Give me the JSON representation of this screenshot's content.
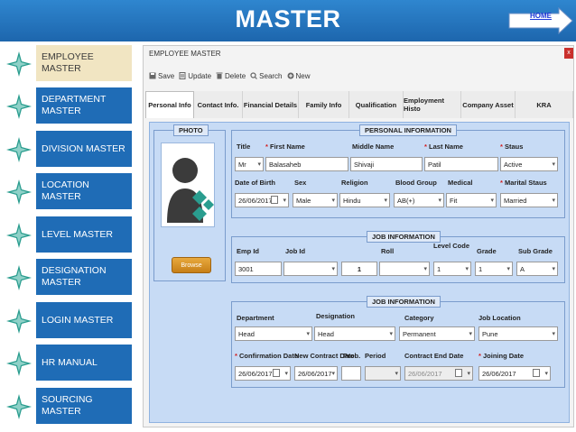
{
  "banner": {
    "title": "MASTER",
    "home_label": "HOME"
  },
  "sidebar": {
    "items": [
      {
        "label": "EMPLOYEE MASTER",
        "active": true
      },
      {
        "label": "DEPARTMENT MASTER",
        "active": false
      },
      {
        "label": "DIVISION MASTER",
        "active": false
      },
      {
        "label": "LOCATION MASTER",
        "active": false
      },
      {
        "label": "LEVEL MASTER",
        "active": false
      },
      {
        "label": "DESIGNATION MASTER",
        "active": false
      },
      {
        "label": "LOGIN MASTER",
        "active": false
      },
      {
        "label": "HR MANUAL",
        "active": false
      },
      {
        "label": "SOURCING MASTER",
        "active": false
      }
    ]
  },
  "window": {
    "title": "EMPLOYEE MASTER",
    "close_label": "x",
    "toolbar": {
      "save": "Save",
      "update": "Update",
      "delete": "Delete",
      "search": "Search",
      "new": "New"
    },
    "tabs": [
      {
        "label": "Personal Info",
        "active": true
      },
      {
        "label": "Contact Info.",
        "active": false
      },
      {
        "label": "Financial Details",
        "active": false
      },
      {
        "label": "Family Info",
        "active": false
      },
      {
        "label": "Qualification",
        "active": false
      },
      {
        "label": "Employment Histo",
        "active": false
      },
      {
        "label": "Company Asset",
        "active": false
      },
      {
        "label": "KRA",
        "active": false
      }
    ]
  },
  "photo": {
    "title": "PHOTO",
    "browse_label": "Browse"
  },
  "personal": {
    "title": "PERSONAL INFORMATION",
    "title_label": "Title",
    "title_value": "Mr",
    "first_name_label": "First Name",
    "first_name_value": "Balasaheb",
    "middle_name_label": "Middle Name",
    "middle_name_value": "Shivaji",
    "last_name_label": "Last Name",
    "last_name_value": "Patil",
    "status_label": "Staus",
    "status_value": "Active",
    "dob_label": "Date of Birth",
    "dob_value": "26/06/2017",
    "sex_label": "Sex",
    "sex_value": "Male",
    "religion_label": "Religion",
    "religion_value": "Hindu",
    "blood_label": "Blood Group",
    "blood_value": "AB(+)",
    "medical_label": "Medical",
    "medical_value": "Fit",
    "marital_label": "Marital Staus",
    "marital_value": "Married"
  },
  "job": {
    "title": "JOB INFORMATION",
    "emp_id_label": "Emp Id",
    "emp_id_value": "3001",
    "job_id_label": "Job Id",
    "job_id_value": "",
    "roll_label": "Roll",
    "roll_value": "1",
    "roll_select_value": "",
    "level_label": "Level Code",
    "level_value": "1",
    "grade_label": "Grade",
    "grade_value": "1",
    "sub_grade_label": "Sub Grade",
    "sub_grade_value": "A"
  },
  "job2": {
    "title": "JOB INFORMATION",
    "department_label": "Department",
    "department_value": "Head",
    "designation_label": "Designation",
    "designation_value": "Head",
    "category_label": "Category",
    "category_value": "Permanent",
    "location_label": "Job Location",
    "location_value": "Pune",
    "confirmation_label": "Confirmation Date",
    "confirmation_value": "26/06/2017",
    "new_contract_label": "New Contract Date",
    "new_contract_value": "26/06/2017",
    "prob_label": "Prob.",
    "prob_value": "",
    "period_label": "Period",
    "period_value": "",
    "contract_end_label": "Contract End Date",
    "contract_end_value": "26/06/2017",
    "joining_label": "Joining Date",
    "joining_value": "26/06/2017"
  },
  "colors": {
    "banner": "#1f6cb6",
    "sidebar_item": "#1f6cb6",
    "sidebar_active": "#f1e5c2",
    "panel": "#c7dbf5",
    "required": "#d21f1f"
  }
}
